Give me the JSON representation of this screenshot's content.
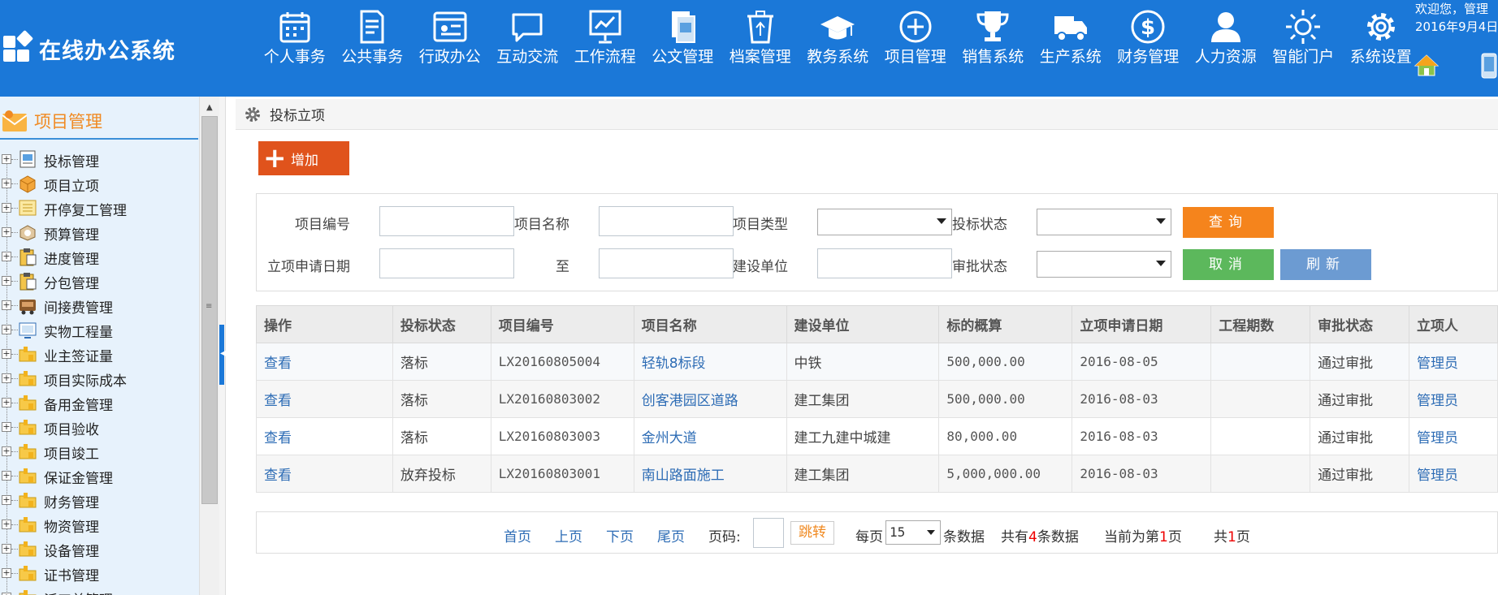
{
  "app": {
    "title": "在线办公系统"
  },
  "header": {
    "welcome_line1": "欢迎您，管理",
    "welcome_line2": "2016年9月4日",
    "nav": [
      {
        "label": "个人事务",
        "icon": "calendar-icon"
      },
      {
        "label": "公共事务",
        "icon": "document-icon"
      },
      {
        "label": "行政办公",
        "icon": "browser-window-icon"
      },
      {
        "label": "互动交流",
        "icon": "chat-bubble-icon"
      },
      {
        "label": "工作流程",
        "icon": "presentation-chart-icon"
      },
      {
        "label": "公文管理",
        "icon": "file-folder-icon"
      },
      {
        "label": "档案管理",
        "icon": "recycle-bin-icon"
      },
      {
        "label": "教务系统",
        "icon": "graduation-cap-icon"
      },
      {
        "label": "项目管理",
        "icon": "plus-circle-icon"
      },
      {
        "label": "销售系统",
        "icon": "trophy-icon"
      },
      {
        "label": "生产系统",
        "icon": "truck-icon"
      },
      {
        "label": "财务管理",
        "icon": "dollar-coin-icon"
      },
      {
        "label": "人力资源",
        "icon": "user-icon"
      },
      {
        "label": "智能门户",
        "icon": "sun-icon"
      },
      {
        "label": "系统设置",
        "icon": "gear-icon"
      }
    ]
  },
  "sidebar": {
    "title": "项目管理",
    "items": [
      {
        "label": "投标管理",
        "icon": "bid-document-icon"
      },
      {
        "label": "项目立项",
        "icon": "box-icon"
      },
      {
        "label": "开停复工管理",
        "icon": "list-icon"
      },
      {
        "label": "预算管理",
        "icon": "package-icon"
      },
      {
        "label": "进度管理",
        "icon": "clipboard-icon"
      },
      {
        "label": "分包管理",
        "icon": "clipboard-icon"
      },
      {
        "label": "间接费管理",
        "icon": "cart-icon"
      },
      {
        "label": "实物工程量",
        "icon": "screen-icon"
      },
      {
        "label": "业主签证量",
        "icon": "folder-icon"
      },
      {
        "label": "项目实际成本",
        "icon": "folder-icon"
      },
      {
        "label": "备用金管理",
        "icon": "folder-icon"
      },
      {
        "label": "项目验收",
        "icon": "folder-icon"
      },
      {
        "label": "项目竣工",
        "icon": "folder-icon"
      },
      {
        "label": "保证金管理",
        "icon": "folder-icon"
      },
      {
        "label": "财务管理",
        "icon": "folder-icon"
      },
      {
        "label": "物资管理",
        "icon": "folder-icon"
      },
      {
        "label": "设备管理",
        "icon": "folder-icon"
      },
      {
        "label": "证书管理",
        "icon": "folder-icon"
      },
      {
        "label": "派工单管理",
        "icon": "folder-icon"
      }
    ]
  },
  "breadcrumb": {
    "label": "投标立项"
  },
  "toolbar": {
    "add_label": "增加"
  },
  "search": {
    "project_no_label": "项目编号",
    "project_name_label": "项目名称",
    "project_type_label": "项目类型",
    "bid_status_label": "投标状态",
    "apply_date_label": "立项申请日期",
    "to_label": "至",
    "builder_label": "建设单位",
    "approve_status_label": "审批状态",
    "query_label": "查询",
    "cancel_label": "取消",
    "refresh_label": "刷新",
    "colors": {
      "query": "#f5841c",
      "cancel": "#5cb85c",
      "refresh": "#6c9bd2"
    }
  },
  "table": {
    "columns": [
      "操作",
      "投标状态",
      "项目编号",
      "项目名称",
      "建设单位",
      "标的概算",
      "立项申请日期",
      "工程期数",
      "审批状态",
      "立项人"
    ],
    "rows": [
      {
        "action": "查看",
        "bid_status": "落标",
        "project_no": "LX20160805004",
        "project_name": "轻轨8标段",
        "builder": "中铁",
        "budget": "500,000.00",
        "apply_date": "2016-08-05",
        "phases": "",
        "approve_status": "通过审批",
        "creator": "管理员"
      },
      {
        "action": "查看",
        "bid_status": "落标",
        "project_no": "LX20160803002",
        "project_name": "创客港园区道路",
        "builder": "建工集团",
        "budget": "500,000.00",
        "apply_date": "2016-08-03",
        "phases": "",
        "approve_status": "通过审批",
        "creator": "管理员"
      },
      {
        "action": "查看",
        "bid_status": "落标",
        "project_no": "LX20160803003",
        "project_name": "金州大道",
        "builder": "建工九建中城建",
        "budget": "80,000.00",
        "apply_date": "2016-08-03",
        "phases": "",
        "approve_status": "通过审批",
        "creator": "管理员"
      },
      {
        "action": "查看",
        "bid_status": "放弃投标",
        "project_no": "LX20160803001",
        "project_name": "南山路面施工",
        "builder": "建工集团",
        "budget": "5,000,000.00",
        "apply_date": "2016-08-03",
        "phases": "",
        "approve_status": "通过审批",
        "creator": "管理员"
      }
    ]
  },
  "pager": {
    "first": "首页",
    "prev": "上页",
    "next": "下页",
    "last": "尾页",
    "page_no_label": "页码:",
    "jump_label": "跳转",
    "per_page_prefix": "每页",
    "per_page_value": "15",
    "per_page_suffix": "条数据",
    "total_prefix": "共有",
    "total_count": "4",
    "total_suffix": "条数据",
    "current_prefix": "当前为第",
    "current_page": "1",
    "current_suffix": "页",
    "pages_prefix": "共",
    "pages_count": "1",
    "pages_suffix": "页"
  }
}
